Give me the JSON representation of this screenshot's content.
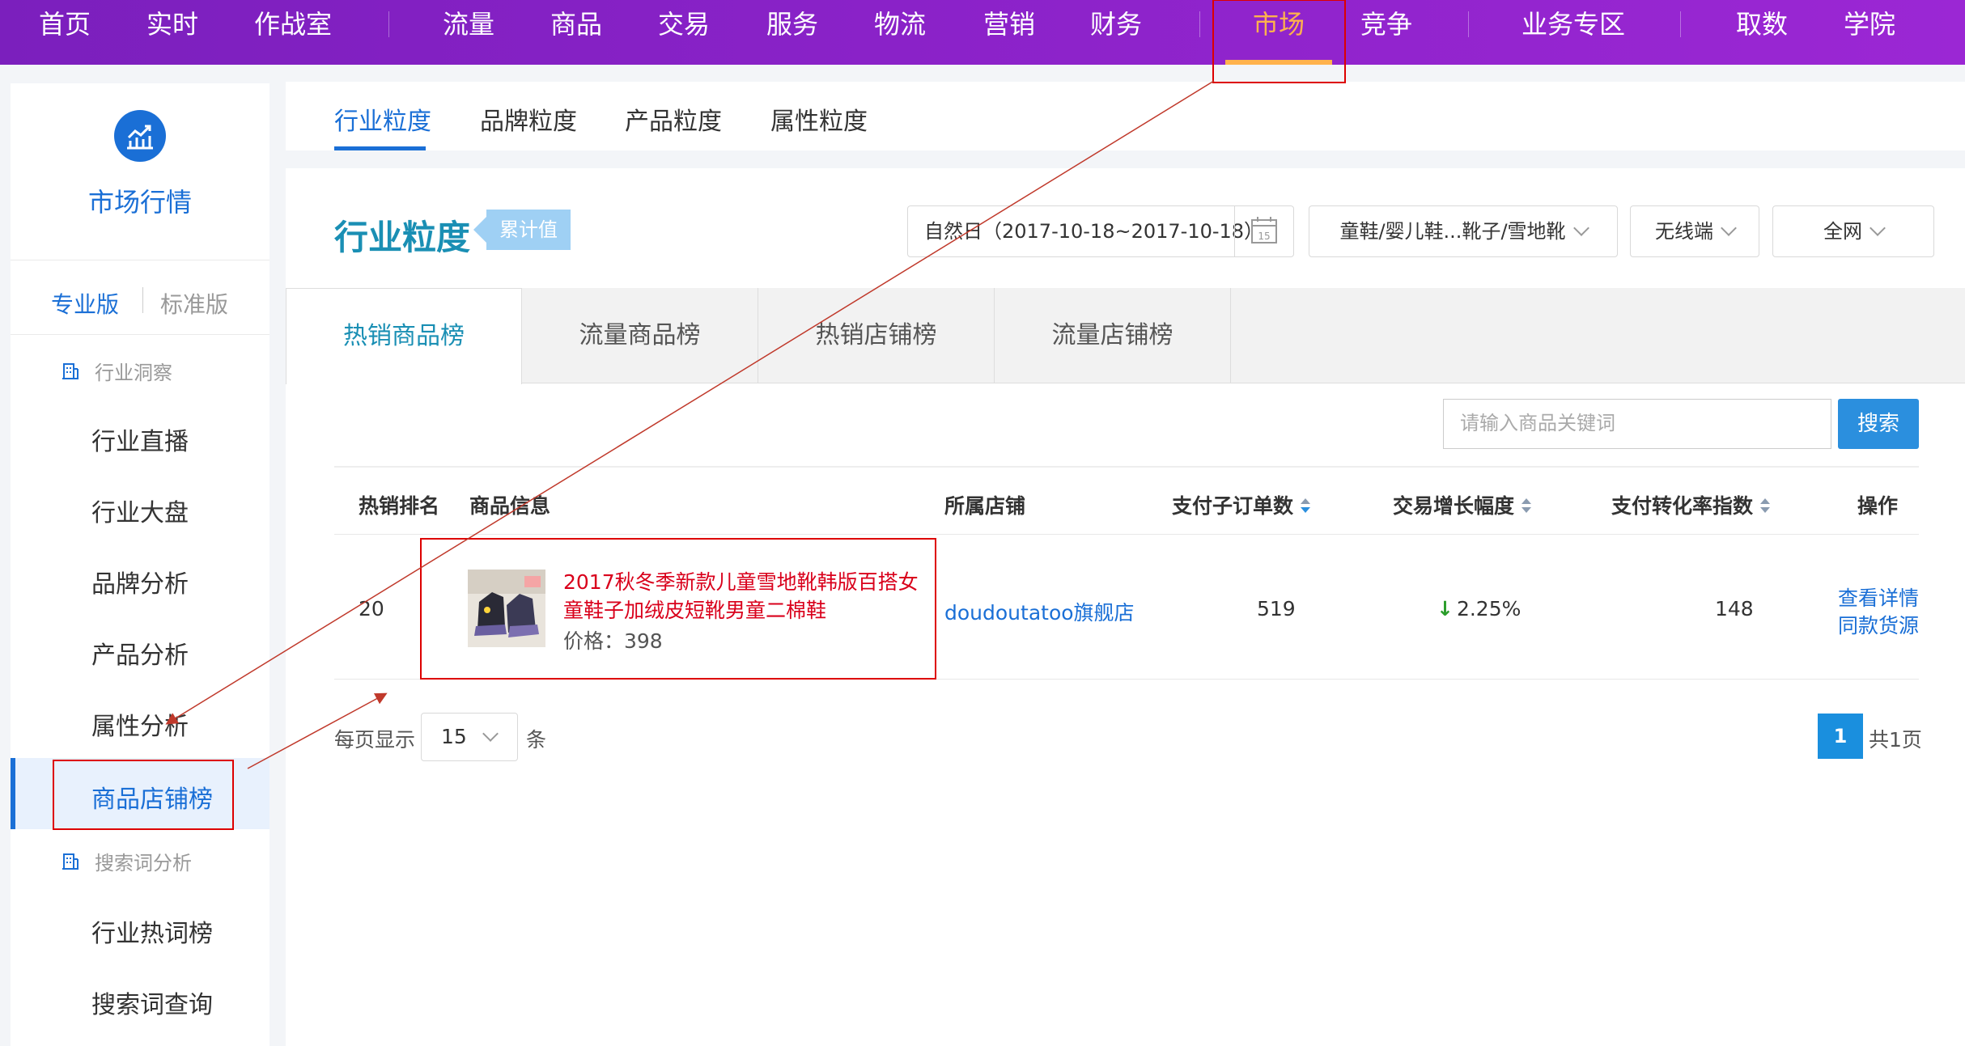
{
  "topnav": {
    "items": [
      "首页",
      "实时",
      "作战室",
      "流量",
      "商品",
      "交易",
      "服务",
      "物流",
      "营销",
      "财务",
      "市场",
      "竞争",
      "业务专区",
      "取数",
      "学院"
    ],
    "active": "市场",
    "active_color": "#ffb24d"
  },
  "sidebar": {
    "title": "市场行情",
    "editions": {
      "pro": "专业版",
      "standard": "标准版"
    },
    "groups": [
      {
        "label": "行业洞察",
        "items": [
          "行业直播",
          "行业大盘",
          "品牌分析",
          "产品分析",
          "属性分析",
          "商品店铺榜"
        ]
      },
      {
        "label": "搜索词分析",
        "items": [
          "行业热词榜",
          "搜索词查询"
        ]
      }
    ],
    "active_item": "商品店铺榜"
  },
  "subtabs": [
    "行业粒度",
    "品牌粒度",
    "产品粒度",
    "属性粒度"
  ],
  "panel": {
    "title": "行业粒度",
    "badge": "累计值",
    "filters": {
      "date": "自然日（2017-10-18~2017-10-18）",
      "date_icon_day": "15",
      "category": "童鞋/婴儿鞋...靴子/雪地靴",
      "device": "无线端",
      "scope": "全网"
    }
  },
  "rank_tabs": [
    "热销商品榜",
    "流量商品榜",
    "热销店铺榜",
    "流量店铺榜"
  ],
  "search": {
    "placeholder": "请输入商品关键词",
    "button": "搜索"
  },
  "table": {
    "headers": [
      "热销排名",
      "商品信息",
      "所属店铺",
      "支付子订单数",
      "交易增长幅度",
      "支付转化率指数",
      "操作"
    ],
    "rows": [
      {
        "rank": "20",
        "product_title": "2017秋冬季新款儿童雪地靴韩版百搭女童鞋子加绒皮短靴男童二棉鞋",
        "price": "价格：398",
        "shop": "doudoutatoo旗舰店",
        "orders": "519",
        "growth": "2.25%",
        "conversion_index": "148",
        "actions": [
          "查看详情",
          "同款货源"
        ]
      }
    ]
  },
  "pagination": {
    "per_page_label": "每页显示",
    "per_page": "15",
    "unit": "条",
    "current_page": "1",
    "total": "共1页"
  },
  "colors": {
    "brand_blue": "#1a6fd6",
    "teal_title": "#1a8fb4",
    "highlight_red": "#d9001b",
    "nav_purple": "#8a22c8"
  }
}
